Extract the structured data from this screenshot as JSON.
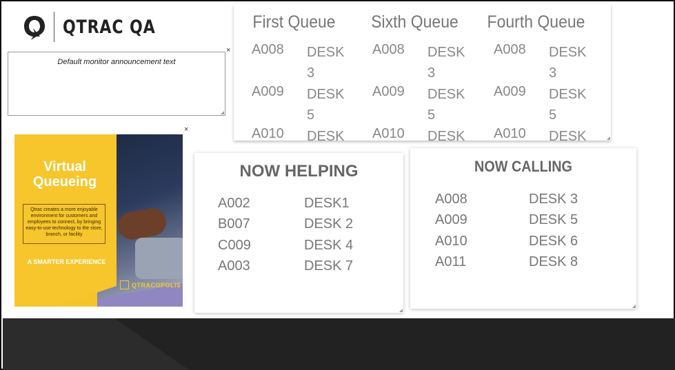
{
  "header": {
    "logo_text": "QTRAC QA"
  },
  "announcement": {
    "text": "Default monitor announcement text",
    "close_label": "×"
  },
  "ad": {
    "close_label": "×",
    "title_line1": "Virtual",
    "title_line2": "Queueing",
    "body": "Qtrac creates a more enjoyable environment for customers and employees to connect, by bringing easy-to-use technology to the store, branch, or facility",
    "tagline": "A SMARTER EXPERIENCE",
    "brand": "QTRACOPOLIS"
  },
  "queues": [
    {
      "title": "First Queue",
      "rows": [
        {
          "ticket": "A008",
          "desk": "DESK 3"
        },
        {
          "ticket": "A009",
          "desk": "DESK 5"
        },
        {
          "ticket": "A010",
          "desk": "DESK"
        }
      ]
    },
    {
      "title": "Sixth Queue",
      "rows": [
        {
          "ticket": "A008",
          "desk": "DESK 3"
        },
        {
          "ticket": "A009",
          "desk": "DESK 5"
        },
        {
          "ticket": "A010",
          "desk": "DESK"
        }
      ]
    },
    {
      "title": "Fourth Queue",
      "rows": [
        {
          "ticket": "A008",
          "desk": "DESK 3"
        },
        {
          "ticket": "A009",
          "desk": "DESK 5"
        },
        {
          "ticket": "A010",
          "desk": "DESK"
        }
      ]
    }
  ],
  "now_helping": {
    "title": "NOW HELPING",
    "rows": [
      {
        "ticket": "A002",
        "desk": "DESK1"
      },
      {
        "ticket": "B007",
        "desk": "DESK 2"
      },
      {
        "ticket": "C009",
        "desk": "DESK 4"
      },
      {
        "ticket": "A003",
        "desk": "DESK 7"
      }
    ]
  },
  "now_calling": {
    "title": "NOW CALLING",
    "rows": [
      {
        "ticket": "A008",
        "desk": "DESK 3"
      },
      {
        "ticket": "A009",
        "desk": "DESK 5"
      },
      {
        "ticket": "A010",
        "desk": "DESK 6"
      },
      {
        "ticket": "A011",
        "desk": "DESK 8"
      }
    ]
  }
}
